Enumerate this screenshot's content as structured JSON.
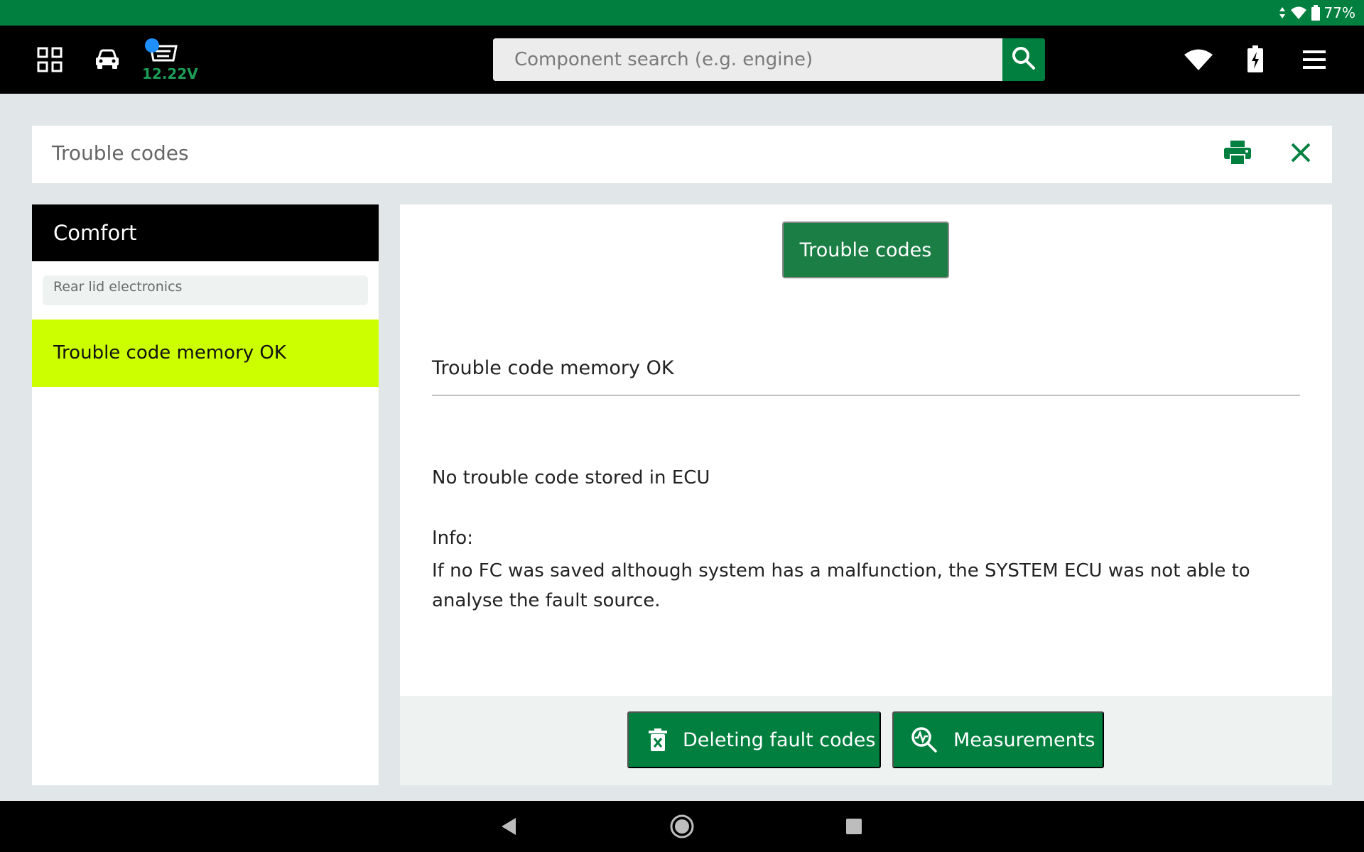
{
  "status_bar": {
    "battery_percent": "77%",
    "icons": [
      "data-arrows-icon",
      "wifi-icon",
      "battery-icon"
    ]
  },
  "app_bar": {
    "voltage": "12.22V",
    "search": {
      "placeholder": "Component search (e.g. engine)",
      "value": ""
    },
    "icons": [
      "grid-icon",
      "car-icon",
      "obd-connector-icon",
      "search-icon",
      "wifi-icon",
      "battery-charging-icon",
      "menu-icon"
    ]
  },
  "title_card": {
    "title": "Trouble codes",
    "icons": [
      "print-icon",
      "close-icon"
    ]
  },
  "sidebar": {
    "header": "Comfort",
    "subheader": "Rear lid electronics",
    "items": [
      {
        "label": "Trouble code memory OK",
        "status_color": "#ccff00"
      }
    ]
  },
  "main": {
    "tab_label": "Trouble codes",
    "result_title": "Trouble code memory OK",
    "message": "No trouble code stored in ECU",
    "info_label": "Info:",
    "info_text": "If no FC was saved although system has a malfunction, the SYSTEM ECU was not able to analyse the fault source.",
    "actions": {
      "delete_label": "Deleting fault codes",
      "measure_label": "Measurements"
    }
  },
  "nav_bar": {
    "icons": [
      "back-icon",
      "home-icon",
      "recents-icon"
    ]
  },
  "colors": {
    "accent": "#007f3f",
    "status_ok": "#ccff00",
    "voltage": "#1c9e57"
  }
}
